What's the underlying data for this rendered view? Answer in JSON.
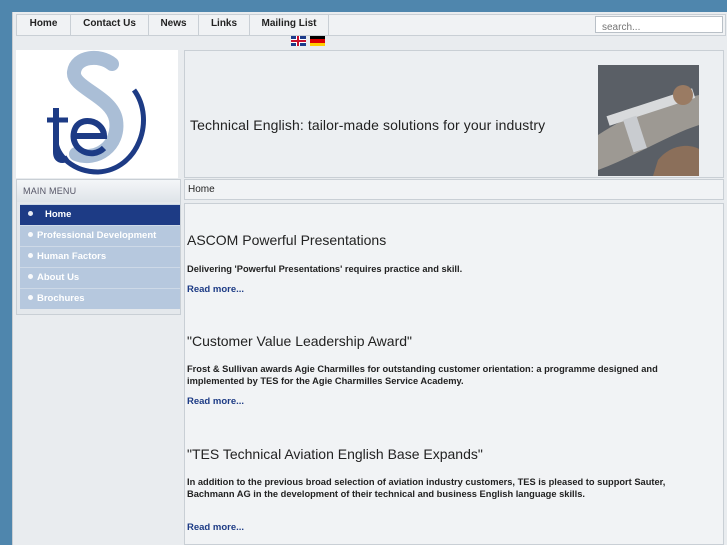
{
  "nav": {
    "items": [
      "Home",
      "Contact Us",
      "News",
      "Links",
      "Mailing List"
    ],
    "search_placeholder": "search..."
  },
  "languages": [
    "English flag",
    "German flag"
  ],
  "header": {
    "logo_text": "tES",
    "banner_title": "Technical English: tailor-made solutions for your industry"
  },
  "sidebar": {
    "heading": "MAIN MENU",
    "items": [
      {
        "label": "Home",
        "active": true
      },
      {
        "label": "Professional Development",
        "active": false
      },
      {
        "label": "Human Factors",
        "active": false
      },
      {
        "label": "About Us",
        "active": false
      },
      {
        "label": "Brochures",
        "active": false
      }
    ]
  },
  "breadcrumb": "Home",
  "articles": [
    {
      "title": "ASCOM Powerful Presentations",
      "text": "Delivering 'Powerful Presentations' requires practice and skill.",
      "read_more": "Read more..."
    },
    {
      "title": "\"Customer Value Leadership Award\"",
      "text": "Frost & Sullivan awards Agie Charmilles for outstanding customer orientation: a programme designed and implemented by TES for the Agie Charmilles Service Academy.",
      "read_more": "Read more..."
    },
    {
      "title": "\"TES Technical Aviation English Base Expands\"",
      "text": "In addition to the previous broad selection of aviation industry customers, TES is pleased to support Sauter, Bachmann AG in the development of their technical and business English language skills.",
      "read_more": "Read more..."
    }
  ],
  "colors": {
    "background": "#4f86ad",
    "menu_active": "#1d3b85",
    "menu_item": "#b6c8de",
    "link": "#1d3b85"
  }
}
